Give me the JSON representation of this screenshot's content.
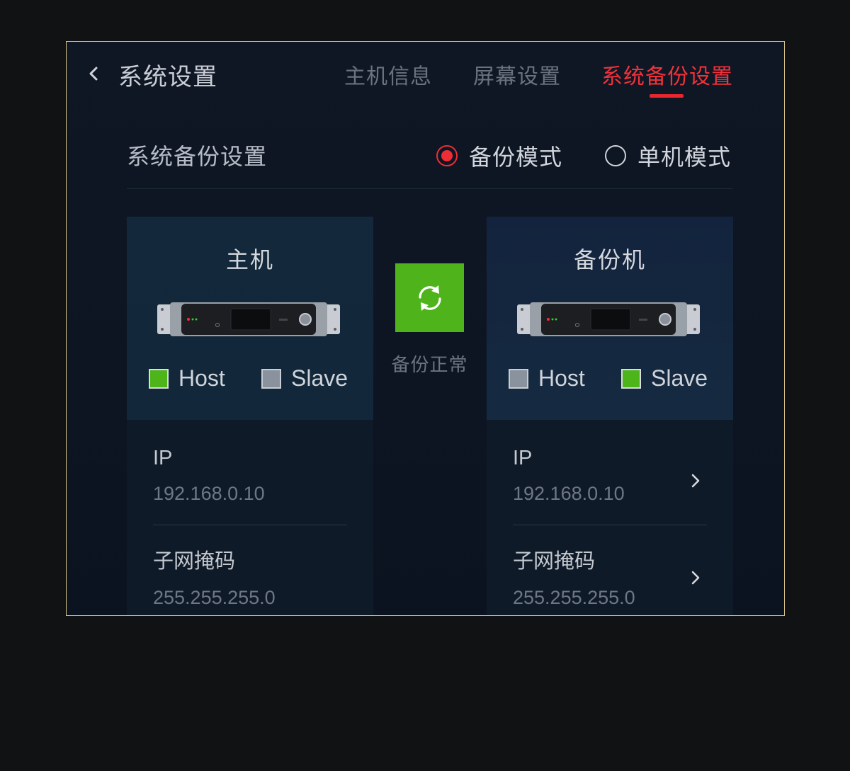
{
  "header": {
    "title": "系统设置",
    "tabs": [
      {
        "label": "主机信息",
        "active": false
      },
      {
        "label": "屏幕设置",
        "active": false
      },
      {
        "label": "系统备份设置",
        "active": true
      }
    ]
  },
  "section": {
    "title": "系统备份设置",
    "modes": [
      {
        "label": "备份模式",
        "checked": true
      },
      {
        "label": "单机模式",
        "checked": false
      }
    ]
  },
  "host_card": {
    "title": "主机",
    "checks": [
      {
        "label": "Host",
        "checked": true
      },
      {
        "label": "Slave",
        "checked": false
      }
    ],
    "fields": [
      {
        "label": "IP",
        "value": "192.168.0.10"
      },
      {
        "label": "子网掩码",
        "value": "255.255.255.0"
      }
    ]
  },
  "sync": {
    "status": "备份正常",
    "icon": "sync-icon"
  },
  "backup_card": {
    "title": "备份机",
    "checks": [
      {
        "label": "Host",
        "checked": false
      },
      {
        "label": "Slave",
        "checked": true
      }
    ],
    "fields": [
      {
        "label": "IP",
        "value": "192.168.0.10"
      },
      {
        "label": "子网掩码",
        "value": "255.255.255.0"
      }
    ]
  },
  "colors": {
    "accent": "#ee2d36",
    "ok_green": "#4fb31b",
    "background": "#111214"
  }
}
